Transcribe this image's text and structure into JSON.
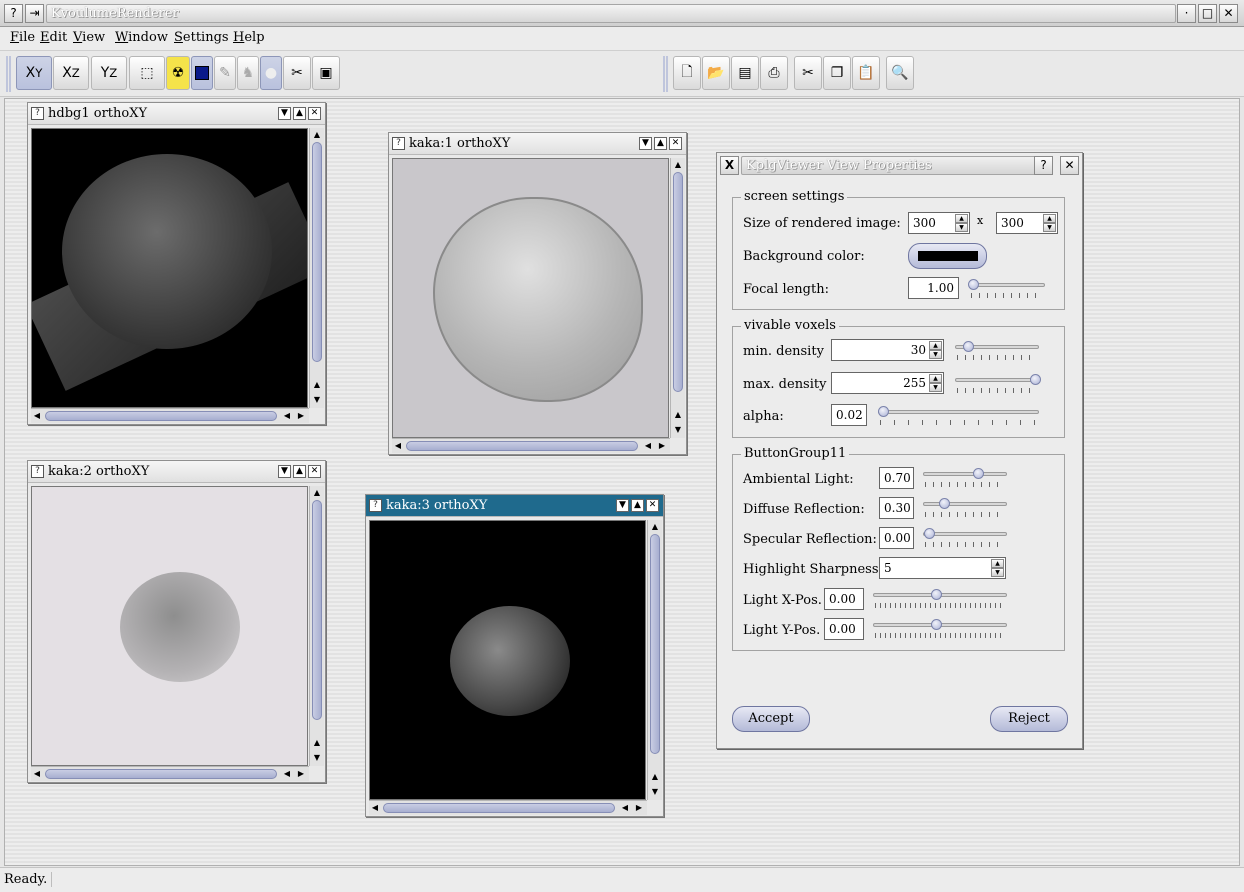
{
  "app": {
    "title": "KvoulumeRenderer"
  },
  "menubar": {
    "items": [
      {
        "label": "File"
      },
      {
        "label": "Edit"
      },
      {
        "label": "View"
      },
      {
        "label": "Window"
      },
      {
        "label": "Settings"
      },
      {
        "label": "Help"
      }
    ]
  },
  "toolbar": {
    "view_buttons": [
      {
        "main": "X",
        "sub": "Y"
      },
      {
        "main": "X",
        "sub": "Z"
      },
      {
        "main": "Y",
        "sub": "Z"
      }
    ]
  },
  "windows": [
    {
      "title": "hdbg1 orthoXY"
    },
    {
      "title": "kaka:1 orthoXY"
    },
    {
      "title": "kaka:2 orthoXY"
    },
    {
      "title": "kaka:3 orthoXY"
    }
  ],
  "dialog": {
    "title": "KplgViewer View Properties",
    "screen": {
      "legend": "screen settings",
      "size_label": "Size of rendered image:",
      "width": "300",
      "x_label": "x",
      "height": "300",
      "bg_label": "Background color:",
      "bg_color": "#000000",
      "focal_label": "Focal length:",
      "focal": "1.00"
    },
    "voxels": {
      "legend": "vivable voxels",
      "min_label": "min. density",
      "min": "30",
      "max_label": "max. density",
      "max": "255",
      "alpha_label": "alpha:",
      "alpha": "0.02"
    },
    "light": {
      "legend": "ButtonGroup11",
      "ambient_label": "Ambiental Light:",
      "ambient": "0.70",
      "diffuse_label": "Diffuse Reflection:",
      "diffuse": "0.30",
      "specular_label": "Specular Reflection:",
      "specular": "0.00",
      "sharp_label": "Highlight Sharpness:",
      "sharp": "5",
      "xpos_label": "Light X-Pos.",
      "xpos": "0.00",
      "ypos_label": "Light Y-Pos.",
      "ypos": "0.00"
    },
    "accept_label": "Accept",
    "reject_label": "Reject"
  },
  "status": {
    "text": "Ready."
  },
  "colors": {
    "active_title": "#1f6a8d",
    "accent": "#a7aed0"
  }
}
